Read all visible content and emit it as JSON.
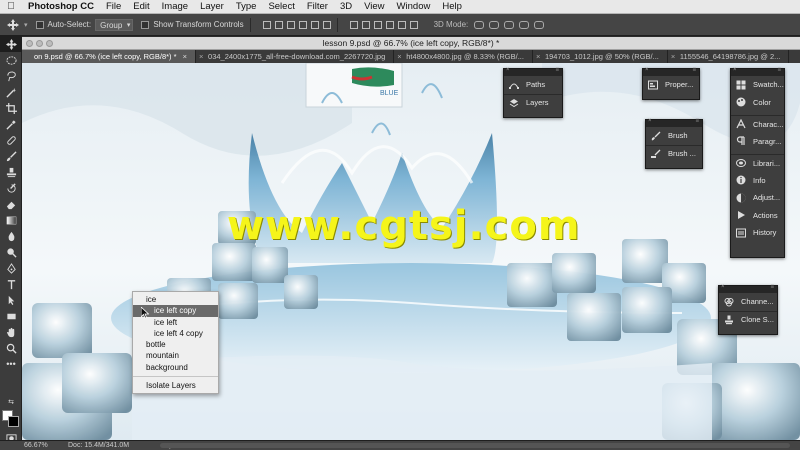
{
  "menubar": {
    "apple_icon": "apple-logo",
    "items": [
      "Photoshop CC",
      "File",
      "Edit",
      "Image",
      "Layer",
      "Type",
      "Select",
      "Filter",
      "3D",
      "View",
      "Window",
      "Help"
    ]
  },
  "options_bar": {
    "auto_select_label": "Auto-Select:",
    "auto_select_value": "Group",
    "transform_label": "Show Transform Controls",
    "mode3d_label": "3D Mode:"
  },
  "document": {
    "title": "lesson 9.psd @ 66.7% (ice left copy, RGB/8*) *",
    "tabs": [
      {
        "label": "on 9.psd @ 66.7% (ice left copy, RGB/8*) *",
        "active": true
      },
      {
        "label": "034_2400x1775_all-free-download.com_2267720.jpg",
        "active": false
      },
      {
        "label": "ht4800x4800.jpg @ 8.33% (RGB/...",
        "active": false
      },
      {
        "label": "194703_1012.jpg @ 50% (RGB/...",
        "active": false
      },
      {
        "label": "1155546_64198786.jpg @ 2...",
        "active": false
      }
    ]
  },
  "canvas": {
    "watermark": "www.cgtsj.com",
    "bottle_label": "BLUE"
  },
  "panels": {
    "group1": [
      "Paths",
      "Layers"
    ],
    "group2": [
      "Proper..."
    ],
    "group3": [
      "Brush",
      "Brush ..."
    ],
    "group4a": [
      "Swatch...",
      "Color"
    ],
    "group4b": [
      "Charac...",
      "Paragr..."
    ],
    "group4c": [
      "Librari...",
      "Info",
      "Adjust...",
      "Actions",
      "History"
    ],
    "group5": [
      "Channe...",
      "Clone S..."
    ]
  },
  "context_menu": {
    "items": [
      {
        "label": "ice",
        "indent": false,
        "highlighted": false
      },
      {
        "label": "ice left copy",
        "indent": true,
        "highlighted": true
      },
      {
        "label": "ice left",
        "indent": true,
        "highlighted": false
      },
      {
        "label": "ice left 4 copy",
        "indent": true,
        "highlighted": false
      },
      {
        "label": "bottle",
        "indent": false,
        "highlighted": false
      },
      {
        "label": "mountain",
        "indent": false,
        "highlighted": false
      },
      {
        "label": "background",
        "indent": false,
        "highlighted": false
      }
    ],
    "footer": "Isolate Layers"
  },
  "status_bar": {
    "zoom": "66.67%",
    "doc": "Doc: 15.4M/341.0M",
    "arrow": "▶"
  },
  "colors": {
    "accent_highlight": "#6a6a6a",
    "watermark": "#f5f51a",
    "water": "#5a9fc9"
  }
}
